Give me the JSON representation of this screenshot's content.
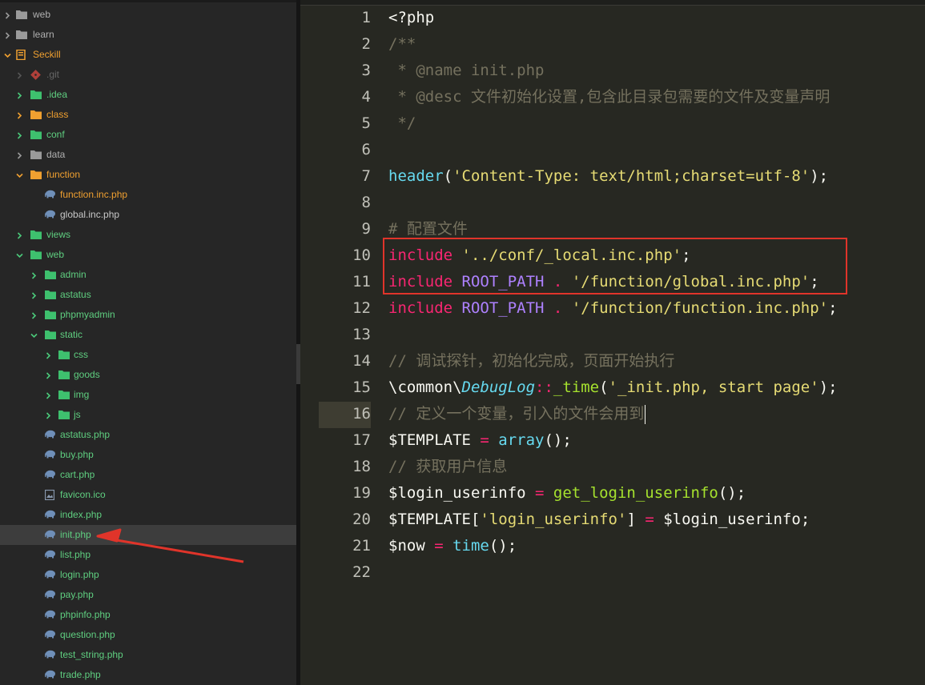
{
  "sidebar": {
    "items": [
      {
        "label": "web",
        "type": "folder",
        "color": "gray",
        "expanded": false,
        "level": 0
      },
      {
        "label": "learn",
        "type": "folder",
        "color": "gray",
        "expanded": false,
        "level": 0
      },
      {
        "label": "Seckill",
        "type": "project",
        "color": "orange",
        "expanded": true,
        "level": 0
      },
      {
        "label": ".git",
        "type": "git",
        "color": "dim",
        "expanded": false,
        "level": 1
      },
      {
        "label": ".idea",
        "type": "folder",
        "color": "green",
        "expanded": false,
        "level": 1
      },
      {
        "label": "class",
        "type": "folder",
        "color": "orange",
        "expanded": false,
        "level": 1
      },
      {
        "label": "conf",
        "type": "folder",
        "color": "green",
        "expanded": false,
        "level": 1
      },
      {
        "label": "data",
        "type": "folder",
        "color": "gray",
        "expanded": false,
        "level": 1
      },
      {
        "label": "function",
        "type": "folder",
        "color": "orange",
        "expanded": true,
        "level": 1
      },
      {
        "label": "function.inc.php",
        "type": "php",
        "color": "orange",
        "level": 2
      },
      {
        "label": "global.inc.php",
        "type": "php",
        "color": "white",
        "level": 2
      },
      {
        "label": "views",
        "type": "folder",
        "color": "green",
        "expanded": false,
        "level": 1
      },
      {
        "label": "web",
        "type": "folder",
        "color": "green",
        "expanded": true,
        "level": 1
      },
      {
        "label": "admin",
        "type": "folder",
        "color": "green",
        "expanded": false,
        "level": 2
      },
      {
        "label": "astatus",
        "type": "folder",
        "color": "green",
        "expanded": false,
        "level": 2
      },
      {
        "label": "phpmyadmin",
        "type": "folder",
        "color": "green",
        "expanded": false,
        "level": 2
      },
      {
        "label": "static",
        "type": "folder",
        "color": "green",
        "expanded": true,
        "level": 2
      },
      {
        "label": "css",
        "type": "folder",
        "color": "green",
        "expanded": false,
        "level": 3
      },
      {
        "label": "goods",
        "type": "folder",
        "color": "green",
        "expanded": false,
        "level": 3
      },
      {
        "label": "img",
        "type": "folder",
        "color": "green",
        "expanded": false,
        "level": 3
      },
      {
        "label": "js",
        "type": "folder",
        "color": "green",
        "expanded": false,
        "level": 3
      },
      {
        "label": "astatus.php",
        "type": "php",
        "color": "green",
        "level": 2
      },
      {
        "label": "buy.php",
        "type": "php",
        "color": "green",
        "level": 2
      },
      {
        "label": "cart.php",
        "type": "php",
        "color": "green",
        "level": 2
      },
      {
        "label": "favicon.ico",
        "type": "image",
        "color": "green",
        "level": 2
      },
      {
        "label": "index.php",
        "type": "php",
        "color": "green",
        "level": 2
      },
      {
        "label": "init.php",
        "type": "php",
        "color": "green",
        "level": 2,
        "selected": true
      },
      {
        "label": "list.php",
        "type": "php",
        "color": "green",
        "level": 2
      },
      {
        "label": "login.php",
        "type": "php",
        "color": "green",
        "level": 2
      },
      {
        "label": "pay.php",
        "type": "php",
        "color": "green",
        "level": 2
      },
      {
        "label": "phpinfo.php",
        "type": "php",
        "color": "green",
        "level": 2
      },
      {
        "label": "question.php",
        "type": "php",
        "color": "green",
        "level": 2
      },
      {
        "label": "test_string.php",
        "type": "php",
        "color": "green",
        "level": 2
      },
      {
        "label": "trade.php",
        "type": "php",
        "color": "green",
        "level": 2
      }
    ]
  },
  "editor": {
    "line_numbers": [
      "1",
      "2",
      "3",
      "4",
      "5",
      "6",
      "7",
      "8",
      "9",
      "10",
      "11",
      "12",
      "13",
      "14",
      "15",
      "16",
      "17",
      "18",
      "19",
      "20",
      "21",
      "22"
    ],
    "active_line": "16",
    "code": {
      "l1": "<?php",
      "l2": "/**",
      "l3": " * @name init.php",
      "l4": " * @desc 文件初始化设置,包含此目录包需要的文件及变量声明",
      "l5": " */",
      "l7_fn": "header",
      "l7_open": "(",
      "l7_str": "'Content-Type: text/html;charset=utf-8'",
      "l7_close": ");",
      "l9": "# 配置文件",
      "l10_kw": "include",
      "l10_str": "'../conf/_local.inc.php'",
      "l10_end": ";",
      "l11_kw": "include",
      "l11_const": "ROOT_PATH",
      "l11_op": " . ",
      "l11_str": "'/function/global.inc.php'",
      "l11_end": ";",
      "l12_kw": "include",
      "l12_const": "ROOT_PATH",
      "l12_op": " . ",
      "l12_str": "'/function/function.inc.php'",
      "l12_end": ";",
      "l14": "// 调试探针，初始化完成，页面开始执行",
      "l15_ns": "\\common\\",
      "l15_cls": "DebugLog",
      "l15_op": "::",
      "l15_fn": "_time",
      "l15_open": "(",
      "l15_str": "'_init.php, start page'",
      "l15_close": ");",
      "l16": "// 定义一个变量，引入的文件会用到",
      "l17_var": "$TEMPLATE",
      "l17_op": " = ",
      "l17_fn": "array",
      "l17_end": "();",
      "l18": "// 获取用户信息",
      "l19_var": "$login_userinfo",
      "l19_op": " = ",
      "l19_fn": "get_login_userinfo",
      "l19_end": "();",
      "l20_var": "$TEMPLATE",
      "l20_open": "[",
      "l20_str": "'login_userinfo'",
      "l20_close": "]",
      "l20_op": " = ",
      "l20_var2": "$login_userinfo",
      "l20_end": ";",
      "l21_var": "$now",
      "l21_op": " = ",
      "l21_fn": "time",
      "l21_end": "();"
    }
  },
  "colors": {
    "keyword": "#f92672",
    "string": "#e6db74",
    "comment": "#75715e",
    "function": "#66d9ef",
    "constant": "#ae81ff",
    "annotation": "#e0342a"
  },
  "icons": {
    "collapse": "chevron-left-icon",
    "folder": "folder-icon",
    "php": "php-elephant-icon",
    "git": "git-icon",
    "project": "book-icon",
    "image": "image-file-icon"
  }
}
